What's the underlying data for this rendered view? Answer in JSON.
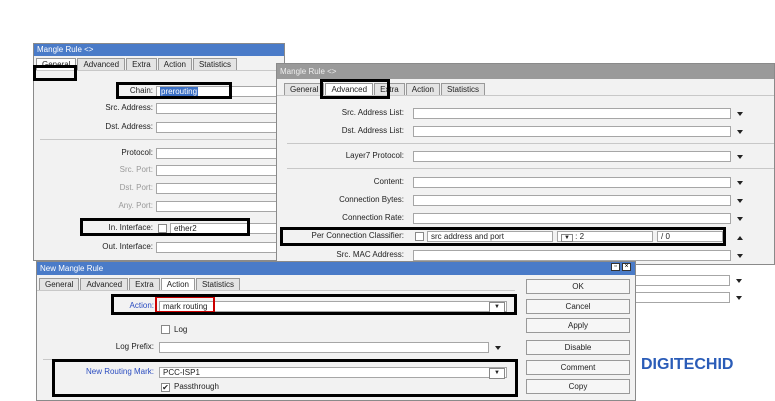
{
  "win1": {
    "title": "Mangle Rule <>",
    "tabs": [
      "General",
      "Advanced",
      "Extra",
      "Action",
      "Statistics"
    ],
    "fields": {
      "chain_label": "Chain:",
      "chain_value": "prerouting",
      "src_address": "Src. Address:",
      "dst_address": "Dst. Address:",
      "protocol": "Protocol:",
      "src_port": "Src. Port:",
      "dst_port": "Dst. Port:",
      "any_port": "Any. Port:",
      "in_interface_label": "In. Interface:",
      "in_interface_value": "ether2",
      "out_interface": "Out. Interface:"
    }
  },
  "win2": {
    "title": "Mangle Rule <>",
    "tabs": [
      "General",
      "Advanced",
      "Extra",
      "Action",
      "Statistics"
    ],
    "fields": {
      "src_address_list": "Src. Address List:",
      "dst_address_list": "Dst. Address List:",
      "layer7": "Layer7 Protocol:",
      "content": "Content:",
      "connection_bytes": "Connection Bytes:",
      "connection_rate": "Connection Rate:",
      "pcc_label": "Per Connection Classifier:",
      "pcc_value": "src address and port",
      "pcc_num1": "2",
      "pcc_num2": "0",
      "src_mac": "Src. MAC Address:"
    }
  },
  "win3": {
    "title": "New Mangle Rule",
    "tabs": [
      "General",
      "Advanced",
      "Extra",
      "Action",
      "Statistics"
    ],
    "fields": {
      "action_label": "Action:",
      "action_value": "mark routing",
      "log_label": "Log",
      "log_prefix": "Log Prefix:",
      "new_routing_mark_label": "New Routing Mark:",
      "new_routing_mark_value": "PCC-ISP1",
      "passthrough_label": "Passthrough"
    },
    "buttons": [
      "OK",
      "Cancel",
      "Apply",
      "Disable",
      "Comment",
      "Copy"
    ]
  },
  "brand": "DIGITECHID"
}
